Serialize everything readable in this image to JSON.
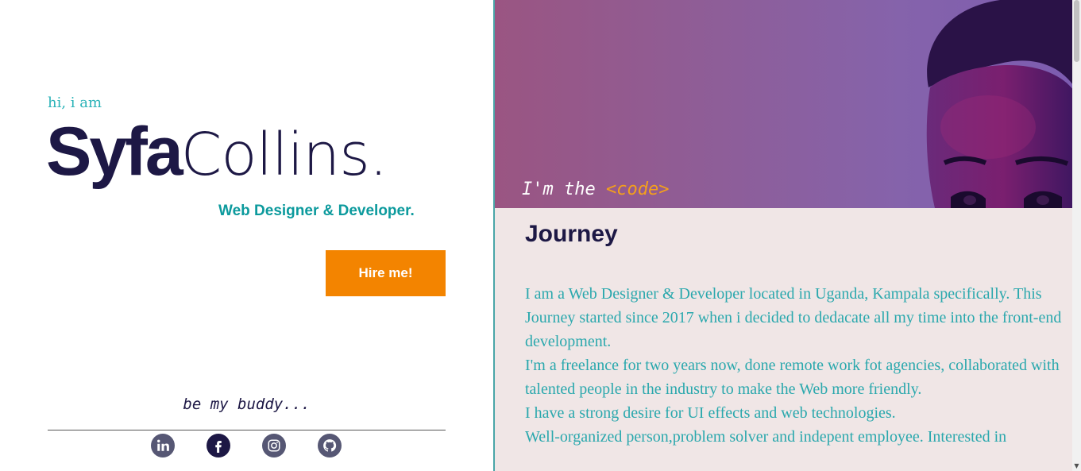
{
  "intro": {
    "greeting": "hi, i am",
    "first_name": "Syfa",
    "last_name": "Collins.",
    "role": "Web Designer & Developer.",
    "hire_label": "Hire me!"
  },
  "social": {
    "tagline": "be my buddy...",
    "links": [
      {
        "name": "LinkedIn",
        "icon": "linkedin-icon"
      },
      {
        "name": "Facebook",
        "icon": "facebook-icon"
      },
      {
        "name": "Instagram",
        "icon": "instagram-icon"
      },
      {
        "name": "GitHub",
        "icon": "github-icon"
      }
    ]
  },
  "hero": {
    "caption_prefix": "I'm the ",
    "caption_code": "<code>"
  },
  "journey": {
    "title": "Journey",
    "paragraphs": [
      "I am a Web Designer & Developer located in Uganda, Kampala specifically. This Journey started since 2017 when i decided to dedacate all my time into the front-end development.",
      "I'm a freelance for two years now, done remote work fot agencies, collaborated with talented people in the industry to make the Web more friendly.",
      "I have a strong desire for UI effects and web technologies.",
      "Well-organized person,problem solver and indepent employee. Interested in"
    ]
  },
  "colors": {
    "navy": "#1d1845",
    "teal": "#2bb3b8",
    "orange": "#f38400",
    "panel_bg": "#f0e6e6"
  }
}
